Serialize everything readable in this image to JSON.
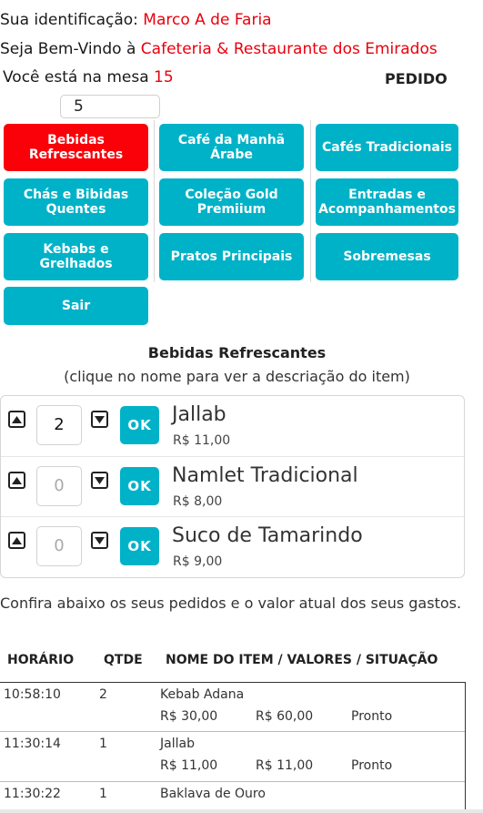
{
  "header": {
    "ident_label": "Sua identificação: ",
    "ident_name": "Marco A de Faria",
    "welcome_label": "Seja Bem-Vindo à ",
    "welcome_place": "Cafeteria & Restaurante dos Emirados",
    "mesa_label": "Você está na mesa ",
    "mesa_number": "15",
    "pedido_label": "PEDIDO",
    "mesa_input_value": "5"
  },
  "categories": [
    {
      "label": "Bebidas Refrescantes",
      "active": true
    },
    {
      "label": "Café da Manhã Árabe"
    },
    {
      "label": "Cafés Tradicionais"
    },
    {
      "label": "Chás e Bibidas Quentes"
    },
    {
      "label": "Coleção Gold Premiium"
    },
    {
      "label": "Entradas e Acompanhamentos"
    },
    {
      "label": "Kebabs e Grelhados"
    },
    {
      "label": "Pratos Principais"
    },
    {
      "label": "Sobremesas"
    },
    {
      "label": "Sair"
    }
  ],
  "section": {
    "title": "Bebidas Refrescantes",
    "subtitle": "(clique no nome para ver a descriação do item)"
  },
  "items": [
    {
      "qty": "2",
      "ok": "OK",
      "name": "Jallab",
      "price": "R$ 11,00"
    },
    {
      "qty": "0",
      "ok": "OK",
      "name": "Namlet Tradicional",
      "price": "R$ 8,00"
    },
    {
      "qty": "0",
      "ok": "OK",
      "name": "Suco de Tamarindo",
      "price": "R$ 9,00"
    }
  ],
  "orders": {
    "intro": "Confira abaixo os seus pedidos e o valor atual dos seus gastos.",
    "headers": {
      "time": "HORÁRIO",
      "qty": "QTDE",
      "item": "NOME DO ITEM / VALORES / SITUAÇÃO"
    },
    "rows": [
      {
        "time": "10:58:10",
        "qty": "2",
        "item": "Kebab Adana",
        "unit": "R$ 30,00",
        "total": "R$ 60,00",
        "status": "Pronto"
      },
      {
        "time": "11:30:14",
        "qty": "1",
        "item": "Jallab",
        "unit": "R$ 11,00",
        "total": "R$ 11,00",
        "status": "Pronto"
      },
      {
        "time": "11:30:22",
        "qty": "1",
        "item": "Baklava de Ouro"
      }
    ]
  },
  "colors": {
    "accent": "#00b2c8",
    "active": "#fa0008",
    "highlight_text": "#e8000d"
  },
  "icons": {
    "qty_up": "arrow-up-box-icon",
    "qty_down": "arrow-down-box-icon"
  }
}
